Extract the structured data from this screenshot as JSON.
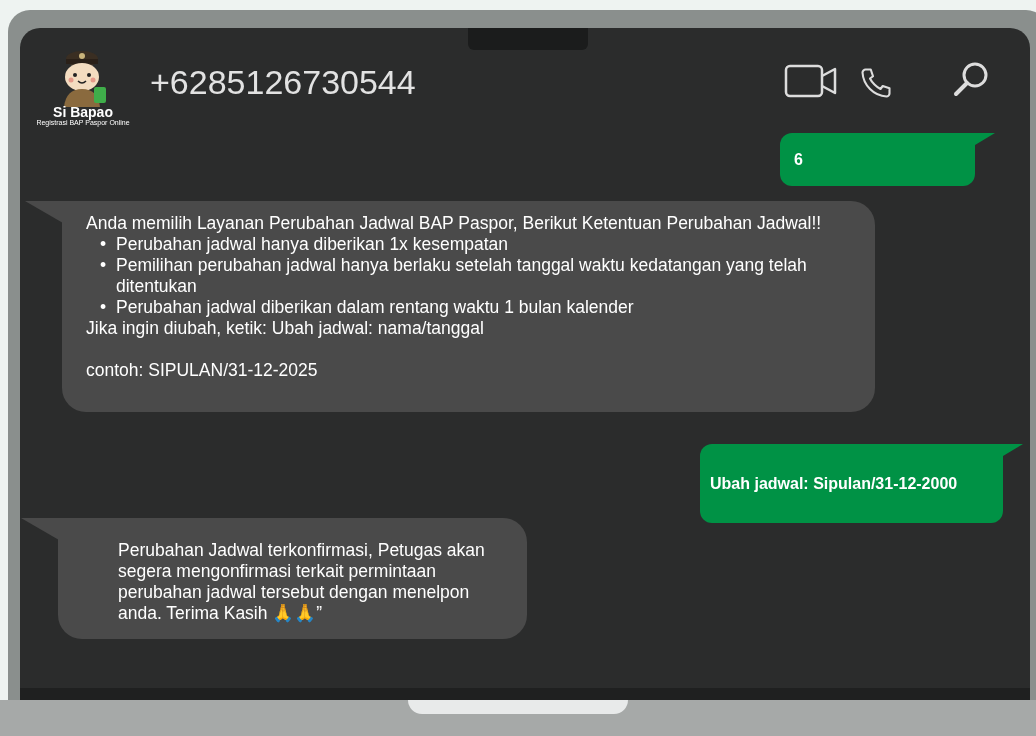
{
  "header": {
    "logo": {
      "name": "Si Bapao",
      "tagline": "Registrasi BAP Paspor Online"
    },
    "contact": "+6285126730544"
  },
  "messages": [
    {
      "kind": "outgoing",
      "sections": [
        {
          "blocks": [
            {
              "text": "6"
            }
          ]
        }
      ]
    },
    {
      "kind": "incoming",
      "sections": [
        {
          "blocks": [
            {
              "text": "Anda memilih Layanan Perubahan Jadwal BAP Paspor, Berikut Ketentuan Perubahan Jadwal!!"
            },
            {
              "items": [
                {
                  "marker": "•",
                  "text": "Perubahan jadwal hanya diberikan 1x kesempatan"
                },
                {
                  "marker": "•",
                  "text": "Pemilihan perubahan jadwal hanya berlaku setelah tanggal waktu kedatangan yang telah ditentukan"
                },
                {
                  "marker": "•",
                  "text": "Perubahan jadwal diberikan dalam rentang waktu 1 bulan kalender"
                }
              ]
            },
            {
              "text": "Jika ingin diubah, ketik: Ubah jadwal: nama/tanggal"
            }
          ]
        },
        {
          "blocks": [
            {
              "text": "contoh: SIPULAN/31-12-2025"
            }
          ]
        }
      ]
    },
    {
      "kind": "outgoing",
      "sections": [
        {
          "blocks": [
            {
              "text": "Ubah jadwal: Sipulan/31-12-2000"
            }
          ]
        }
      ]
    },
    {
      "kind": "incoming",
      "sections": [
        {
          "blocks": [
            {
              "text": "Perubahan Jadwal terkonfirmasi, Petugas akan segera mengonfirmasi terkait permintaan perubahan jadwal tersebut dengan menelpon anda. Terima Kasih 🙏🙏”"
            }
          ]
        }
      ]
    }
  ]
}
